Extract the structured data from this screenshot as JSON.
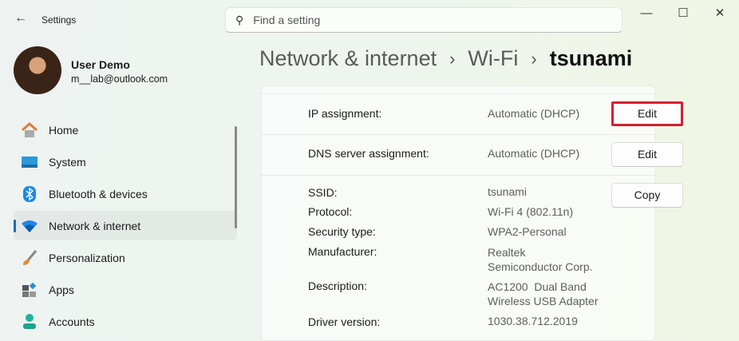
{
  "window": {
    "title": "Settings",
    "controls": {
      "minimize": "—",
      "maximize": "☐",
      "close": "✕"
    }
  },
  "search": {
    "placeholder": "Find a setting"
  },
  "user": {
    "name": "User Demo",
    "email": "m__lab@outlook.com"
  },
  "sidebar": {
    "items": [
      {
        "label": "Home",
        "icon": "home-icon"
      },
      {
        "label": "System",
        "icon": "system-icon"
      },
      {
        "label": "Bluetooth & devices",
        "icon": "bluetooth-icon"
      },
      {
        "label": "Network & internet",
        "icon": "wifi-icon",
        "selected": true
      },
      {
        "label": "Personalization",
        "icon": "brush-icon"
      },
      {
        "label": "Apps",
        "icon": "apps-icon"
      },
      {
        "label": "Accounts",
        "icon": "accounts-icon"
      }
    ]
  },
  "breadcrumb": [
    "Network & internet",
    "Wi-Fi",
    "tsunami"
  ],
  "details": {
    "ip": {
      "label": "IP assignment:",
      "value": "Automatic (DHCP)",
      "button": "Edit"
    },
    "dns": {
      "label": "DNS server assignment:",
      "value": "Automatic (DHCP)",
      "button": "Edit"
    },
    "copy_button": "Copy",
    "rows": [
      {
        "label": "SSID:",
        "value": "tsunami"
      },
      {
        "label": "Protocol:",
        "value": "Wi-Fi 4 (802.11n)"
      },
      {
        "label": "Security type:",
        "value": "WPA2-Personal"
      },
      {
        "label": "Manufacturer:",
        "value": "Realtek",
        "value2": "Semiconductor Corp."
      },
      {
        "label": "Description:",
        "value": "AC1200  Dual Band",
        "value2": "Wireless USB Adapter"
      },
      {
        "label": "Driver version:",
        "value": "1030.38.712.2019"
      }
    ]
  },
  "colors": {
    "accent": "#0f6cbd",
    "highlight": "#d32030"
  }
}
